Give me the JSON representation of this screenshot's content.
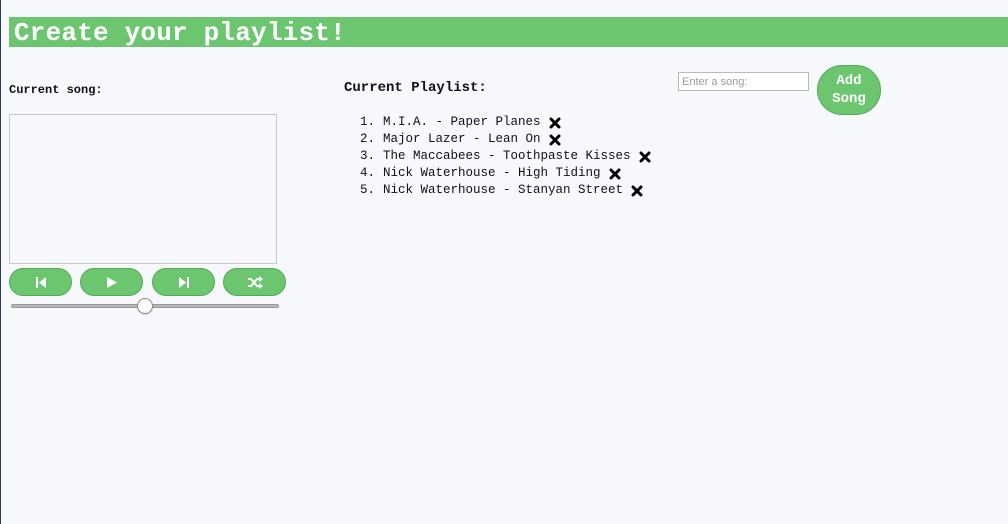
{
  "header": {
    "title": "Create your playlist!"
  },
  "player": {
    "current_song_label": "Current song:",
    "controls": [
      {
        "name": "previous-button",
        "icon": "skip-back-icon"
      },
      {
        "name": "play-button",
        "icon": "play-icon"
      },
      {
        "name": "next-button",
        "icon": "skip-forward-icon"
      },
      {
        "name": "shuffle-button",
        "icon": "shuffle-icon"
      }
    ],
    "volume_level": 0.5
  },
  "playlist": {
    "heading": "Current Playlist:",
    "items": [
      {
        "num": "1.",
        "title": "M.I.A. - Paper Planes"
      },
      {
        "num": "2.",
        "title": "Major Lazer - Lean On"
      },
      {
        "num": "3.",
        "title": "The Maccabees - Toothpaste Kisses"
      },
      {
        "num": "4.",
        "title": "Nick Waterhouse - High Tiding"
      },
      {
        "num": "5.",
        "title": "Nick Waterhouse - Stanyan Street"
      }
    ],
    "remove_icon": "close-x-icon"
  },
  "add_song": {
    "placeholder": "Enter a song:",
    "value": "",
    "button_label": "Add\nSong"
  },
  "colors": {
    "accent": "#6cc66f",
    "background": "#f7f8fc",
    "text": "#111111"
  }
}
